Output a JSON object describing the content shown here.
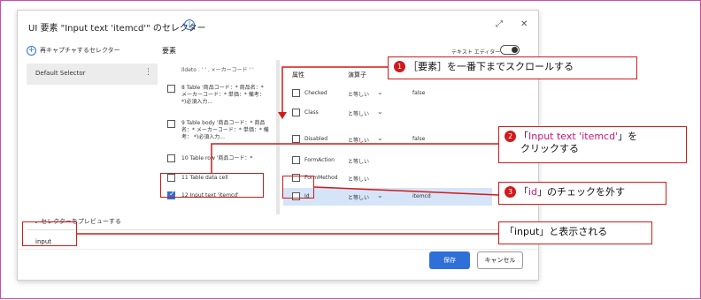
{
  "dialog": {
    "title": "UI 要素 \"Input text 'itemcd'\" のセレクター",
    "maximize_label": "⤢",
    "close_label": "✕",
    "info_icon": "i"
  },
  "left_pane": {
    "add_capture_label": "再キャプチャするセレクター",
    "default_selector_label": "Default Selector",
    "menu_dots": "⋮"
  },
  "elements": {
    "header": "要素",
    "text_editor_label": "テキスト エディター",
    "items": [
      {
        "text": "Ildeto . ' ' . ×ーカーコード ' ' ",
        "checked": false,
        "cut": true
      },
      {
        "text": "8   Table '商品コード：* 商品名：* メーカーコード：* 単価：* 備考： *)必須入力...",
        "checked": false
      },
      {
        "text": "9   Table body '商品コード：* 商品名：* メーカーコード：* 単価：* 備考： *)必須入力...",
        "checked": false
      },
      {
        "text": "10  Table row '商品コード：*",
        "checked": false
      },
      {
        "text": "11  Table data cell",
        "checked": false
      },
      {
        "text": "12  Input text 'itemcd'",
        "checked": true
      }
    ]
  },
  "attributes": {
    "col_attr": "属性",
    "col_op": "演算子",
    "rows": [
      {
        "name": "Checked",
        "op": "と等しい",
        "value": "false",
        "checked": false
      },
      {
        "name": "Class",
        "op": "と等しい",
        "value": "",
        "checked": false
      },
      {
        "name": "Disabled",
        "op": "と等しい",
        "value": "false",
        "checked": false
      },
      {
        "name": "FormAction",
        "op": "と等しい",
        "value": "",
        "checked": false
      },
      {
        "name": "FormMethod",
        "op": "と等しい",
        "value": "",
        "checked": false
      },
      {
        "name": "Id",
        "op": "と等しい",
        "value": "itemcd",
        "checked": false
      }
    ]
  },
  "preview": {
    "toggle_label": "セレクターをプレビューする",
    "text": "input"
  },
  "buttons": {
    "save": "保存",
    "cancel": "キャンセル"
  },
  "callouts": {
    "c1_num": "❶",
    "c1_text": "［要素］を一番下までスクロールする",
    "c2_num": "❷",
    "c2_text_a": "「",
    "c2_text_magenta": "Input text 'itemcd'",
    "c2_text_b": "」を",
    "c2_text_line2": "クリックする",
    "c3_num": "❸",
    "c3_text_a": "「",
    "c3_text_magenta": "id",
    "c3_text_b": "」のチェックを外す",
    "c4_text": "「input」と表示される"
  },
  "colors": {
    "accent": "#2f6fd8",
    "annotation_red": "#d11a1a",
    "frame_magenta": "#c94ea8",
    "highlight_row": "#d6e4f8"
  }
}
